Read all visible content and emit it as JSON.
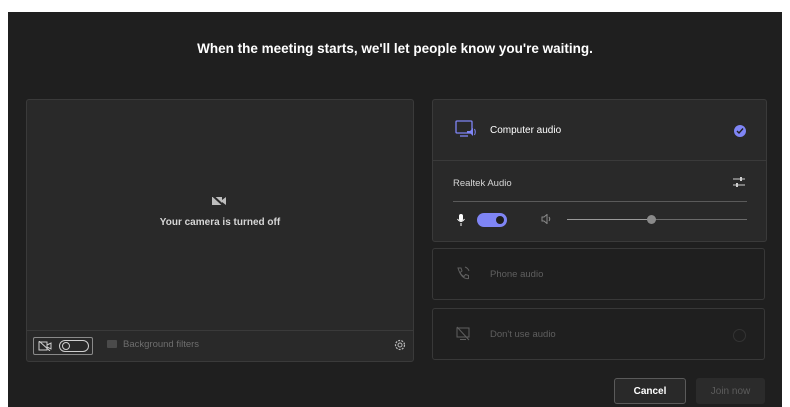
{
  "header": {
    "title": "When the meeting starts, we'll let people know you're waiting."
  },
  "video": {
    "status_text": "Your camera is turned off",
    "background_filters_label": "Background filters",
    "camera_toggle_on": false
  },
  "audio": {
    "computer_audio_label": "Computer audio",
    "computer_audio_selected": true,
    "device_name": "Realtek Audio",
    "mic_on": true,
    "speaker_volume_fraction": 0.47,
    "phone_audio_label": "Phone audio",
    "no_audio_label": "Don't use audio"
  },
  "actions": {
    "cancel_label": "Cancel",
    "join_label": "Join now"
  },
  "colors": {
    "accent": "#7f85f5",
    "background": "#1f1f1f",
    "panel": "#292929"
  },
  "icons": [
    "camera-off-icon",
    "gear-icon",
    "computer-audio-icon",
    "check-icon",
    "sliders-icon",
    "mic-icon",
    "speaker-icon",
    "phone-icon",
    "no-audio-icon",
    "background-filters-icon"
  ]
}
